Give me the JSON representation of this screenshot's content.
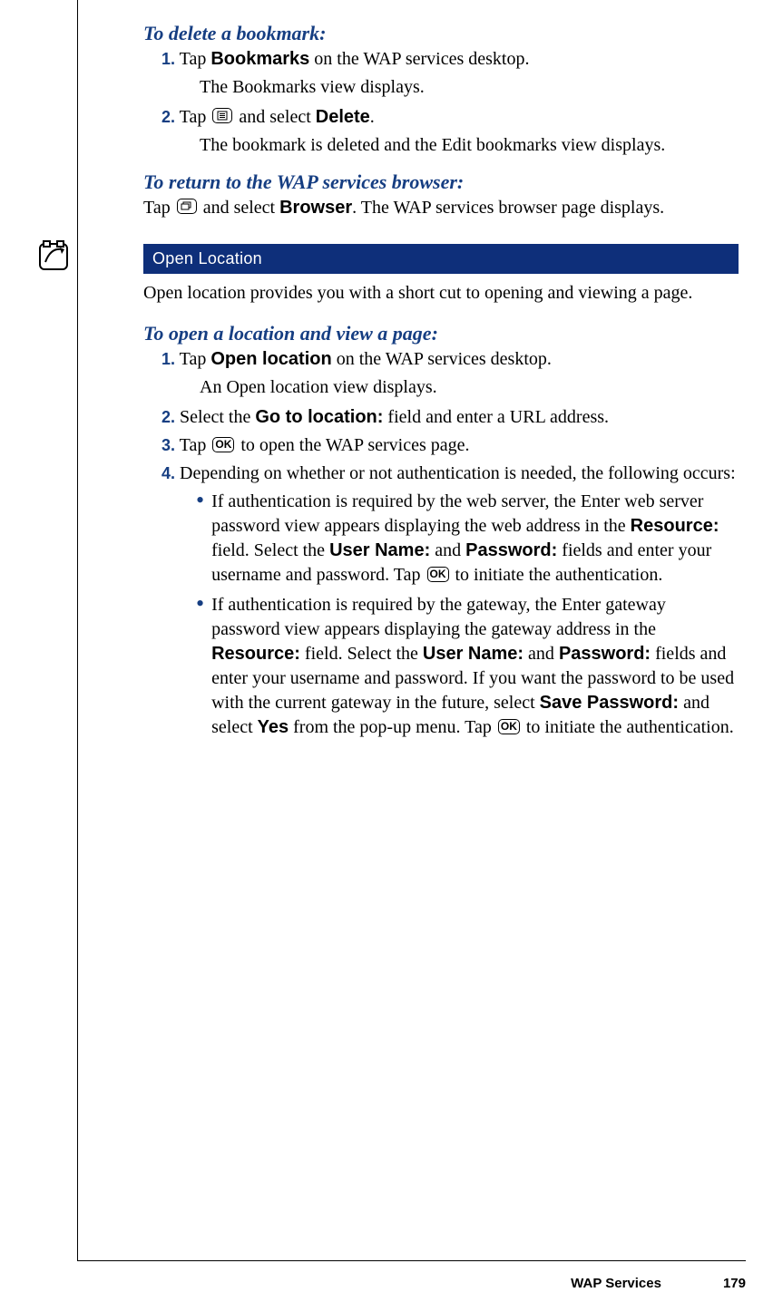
{
  "section1": {
    "heading": "To delete a bookmark:",
    "steps": [
      {
        "num": "1.",
        "text_pre": " Tap ",
        "bold1": "Bookmarks",
        "text_post": " on the WAP services desktop.",
        "follow": "The Bookmarks view displays."
      },
      {
        "num": "2.",
        "text_pre": " Tap ",
        "icon": "list",
        "mid": " and select ",
        "bold1": "Delete",
        "text_post": ".",
        "follow": "The bookmark is deleted and the Edit bookmarks view displays."
      }
    ]
  },
  "section2": {
    "heading": "To return to the WAP services browser:",
    "para_pre": "Tap ",
    "icon": "app",
    "mid": " and select ",
    "bold1": "Browser",
    "post": ". The WAP services browser page displays."
  },
  "section_bar": "Open Location",
  "intro_para": "Open location provides you with a short cut to opening and viewing a page.",
  "section3": {
    "heading": "To open a location and view a page:",
    "step1": {
      "num": "1.",
      "pre": " Tap ",
      "bold": "Open location",
      "post": " on the WAP services desktop.",
      "follow": "An Open location view displays."
    },
    "step2": {
      "num": "2.",
      "pre": " Select the ",
      "bold": "Go to location:",
      "post": " field and enter a URL address."
    },
    "step3": {
      "num": "3.",
      "pre": " Tap ",
      "icon": "OK",
      "post": " to open the WAP services page."
    },
    "step4": {
      "num": "4.",
      "text": " Depending on whether or not authentication is needed, the following occurs:"
    },
    "bullet1": {
      "p1": "If authentication is required by the web server, the Enter web server password view appears displaying the web address in the ",
      "b1": "Resource:",
      "p2": " field. Select the ",
      "b2": "User Name:",
      "p3": " and ",
      "b3": "Password:",
      "p4": " fields and enter your username and password. Tap ",
      "icon": "OK",
      "p5": " to initiate the authentication."
    },
    "bullet2": {
      "p1": "If authentication is required by the gateway, the Enter gateway password view appears displaying the gateway address in the ",
      "b1": "Resource:",
      "p2": " field. Select the ",
      "b2": "User Name:",
      "p3": " and ",
      "b3": "Password:",
      "p4": " fields and enter your username and password. If you want the password to be used with the current gateway in the future, select ",
      "b4": "Save Password:",
      "p5": " and select ",
      "b5": "Yes",
      "p6": " from the pop-up menu. Tap ",
      "icon": "OK",
      "p7": " to initiate the authentication."
    }
  },
  "footer": {
    "chapter": "WAP Services",
    "page": "179"
  }
}
